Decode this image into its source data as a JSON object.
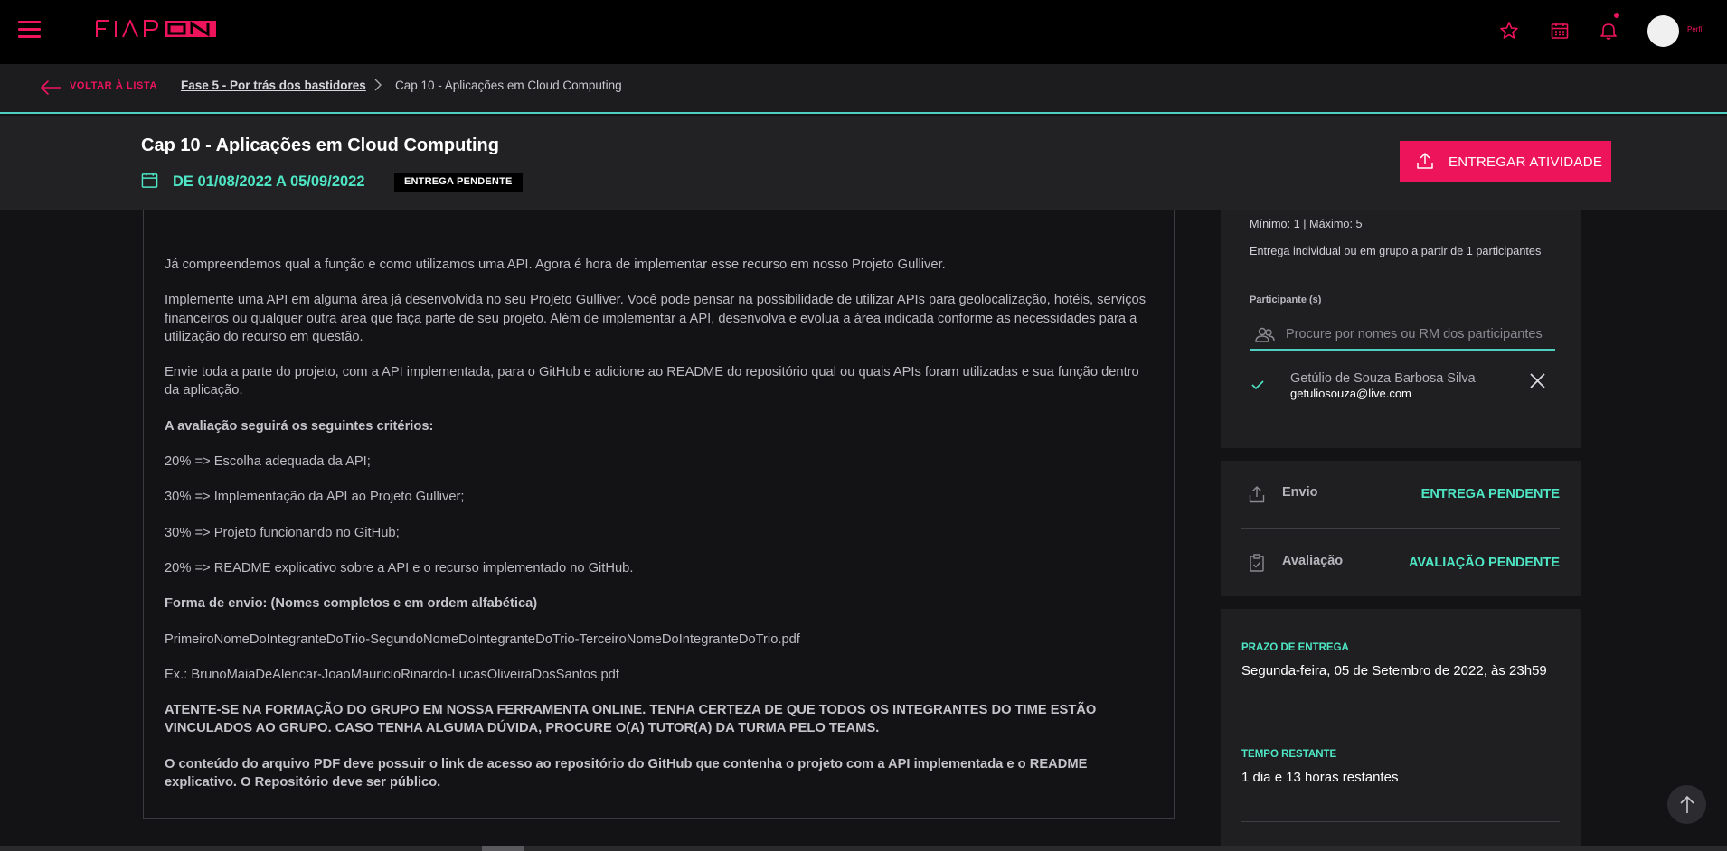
{
  "topbar": {
    "brand": "FIAP ON",
    "profile_label": "Perfil"
  },
  "breadcrumb": {
    "back_label": "VOLTAR À LISTA",
    "items": [
      "Fase 5 - Por trás dos bastidores",
      "Cap 10 - Aplicações em Cloud Computing"
    ]
  },
  "header": {
    "title": "Cap 10 - Aplicações em Cloud Computing",
    "date_range": "DE 01/08/2022 A 05/09/2022",
    "status_badge": "ENTREGA PENDENTE",
    "submit_label": "ENTREGAR ATIVIDADE"
  },
  "content": {
    "paragraphs": [
      "Já compreendemos qual a função e como utilizamos uma API. Agora é hora de implementar esse recurso em nosso Projeto Gulliver.",
      "Implemente uma API em alguma área já desenvolvida no seu Projeto Gulliver. Você pode pensar na possibilidade de utilizar APIs para geolocalização, hotéis, serviços financeiros ou qualquer outra área que faça parte de seu projeto. Além de implementar a API, desenvolva e evolua a área indicada conforme as necessidades para a utilização do recurso em questão.",
      "Envie toda a parte do projeto, com a API implementada, para o GitHub e adicione ao README do repositório qual ou quais APIs foram utilizadas e sua função dentro da aplicação.",
      "A avaliação seguirá os seguintes critérios:",
      "20% => Escolha adequada da API;",
      "30% => Implementação da API ao Projeto Gulliver;",
      "30% => Projeto funcionando no GitHub;",
      "20% => README explicativo sobre a API e o recurso implementado no GitHub.",
      "Forma de envio: (Nomes completos e em ordem alfabética)",
      "PrimeiroNomeDoIntegranteDoTrio-SegundoNomeDoIntegranteDoTrio-TerceiroNomeDoIntegranteDoTrio.pdf",
      "Ex.: BrunoMaiaDeAlencar-JoaoMauricioRinardo-LucasOliveiraDosSantos.pdf",
      "ATENTE-SE NA FORMAÇÃO DO GRUPO EM NOSSA FERRAMENTA ONLINE. TENHA CERTEZA DE QUE TODOS OS INTEGRANTES DO TIME ESTÃO VINCULADOS AO GRUPO. CASO TENHA ALGUMA DÚVIDA, PROCURE O(A) TUTOR(A) DA TURMA PELO TEAMS.",
      "O conteúdo do arquivo PDF deve possuir o link de acesso ao repositório do GitHub que contenha o projeto com a API implementada e o README explicativo. O Repositório deve ser público."
    ]
  },
  "group": {
    "min_max": "Mínimo: 1 | Máximo: 5",
    "description": "Entrega individual ou em grupo a partir de 1 participantes",
    "participants_label": "Participante (s)",
    "search_placeholder": "Procure por nomes ou RM dos participantes",
    "participant": {
      "name": "Getúlio de Souza Barbosa Silva",
      "email": "getuliosouza@live.com"
    }
  },
  "status": {
    "envio_label": "Envio",
    "envio_value": "ENTREGA PENDENTE",
    "avaliacao_label": "Avaliação",
    "avaliacao_value": "AVALIAÇÃO PENDENTE"
  },
  "deadline": {
    "label": "PRAZO DE ENTREGA",
    "value": "Segunda-feira, 05 de Setembro de 2022, às 23h59",
    "remaining_label": "TEMPO RESTANTE",
    "remaining_value": "1 dia e 13 horas restantes"
  },
  "colors": {
    "accent": "#ed145b",
    "teal": "#4ee6c4",
    "background": "#131315"
  },
  "icons": [
    "hamburger-icon",
    "star-icon",
    "calendar-icon",
    "bell-icon",
    "back-arrow-icon",
    "chevron-right-icon",
    "upload-icon",
    "group-icon",
    "check-icon",
    "close-icon",
    "clipboard-icon",
    "arrow-up-icon"
  ]
}
